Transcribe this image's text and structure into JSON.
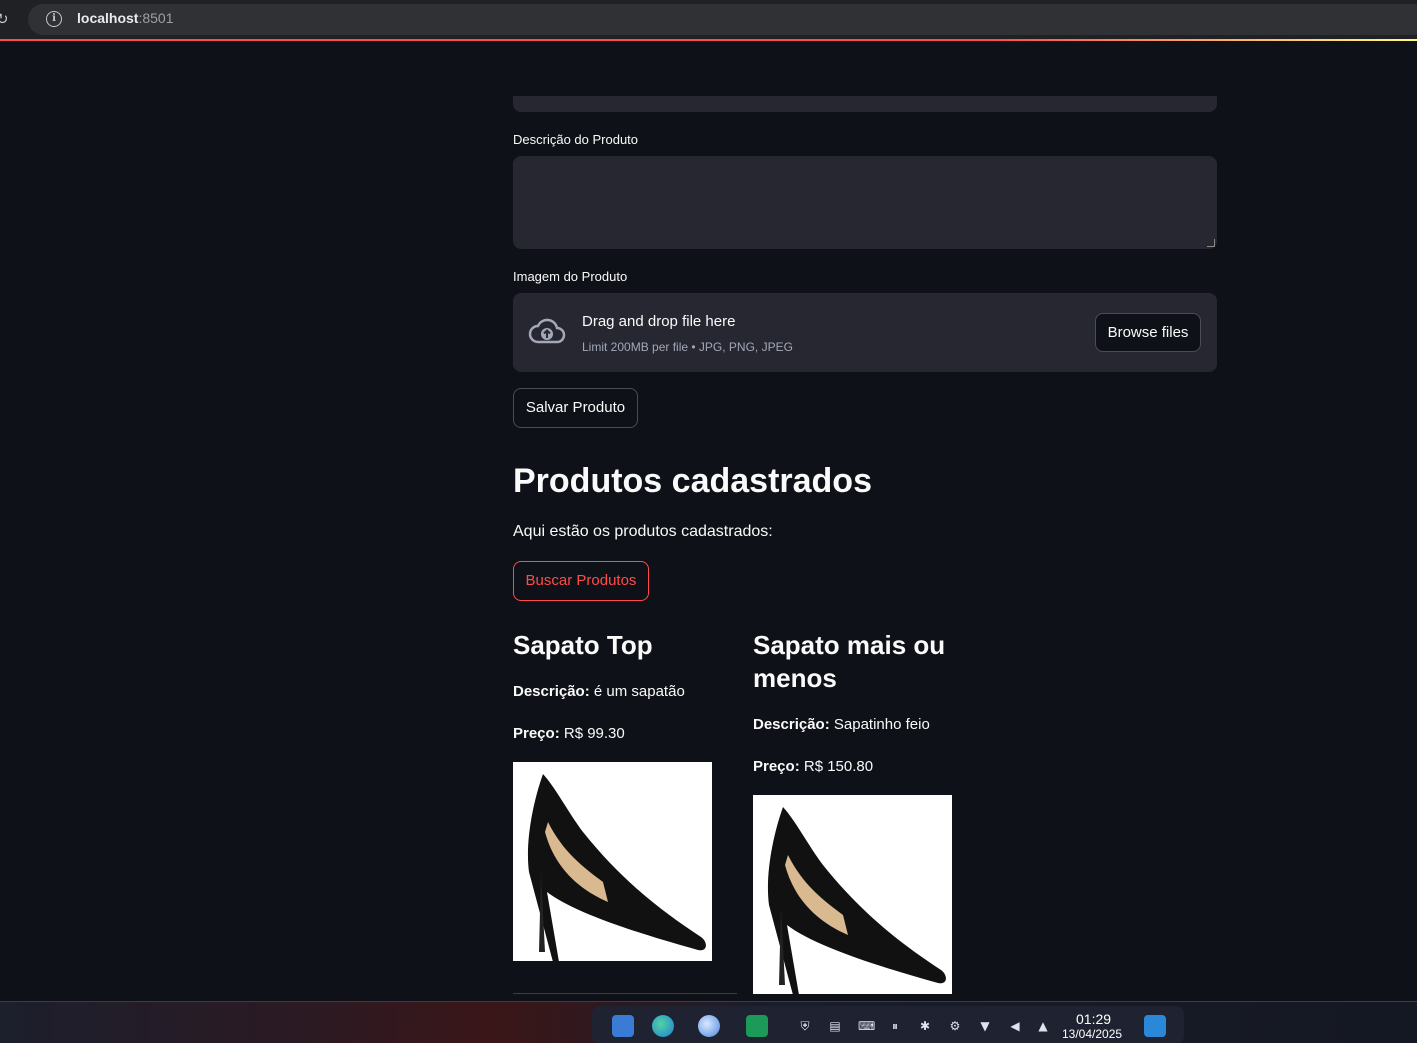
{
  "browser": {
    "url_host": "localhost",
    "url_port": ":8501"
  },
  "form": {
    "description_label": "Descrição do Produto",
    "description_value": "",
    "image_label": "Imagem do Produto",
    "uploader": {
      "drop_text": "Drag and drop file here",
      "limit_text": "Limit 200MB per file • JPG, PNG, JPEG",
      "browse_label": "Browse files",
      "icon": "cloud-upload-icon"
    },
    "save_label": "Salvar Produto"
  },
  "products_section": {
    "title": "Produtos cadastrados",
    "subtitle": "Aqui estão os produtos cadastrados:",
    "search_label": "Buscar Produtos",
    "search_color": "#ff4b4b",
    "items": [
      {
        "name": "Sapato Top",
        "desc_label": "Descrição:",
        "desc_value": " é um sapatão",
        "price_label": "Preço:",
        "price_value": " R$ 99.30"
      },
      {
        "name": "Sapato mais ou menos",
        "desc_label": "Descrição:",
        "desc_value": " Sapatinho feio",
        "price_label": "Preço:",
        "price_value": " R$ 150.80"
      }
    ]
  },
  "taskbar": {
    "time": "01:29",
    "date": "13/04/2025"
  }
}
